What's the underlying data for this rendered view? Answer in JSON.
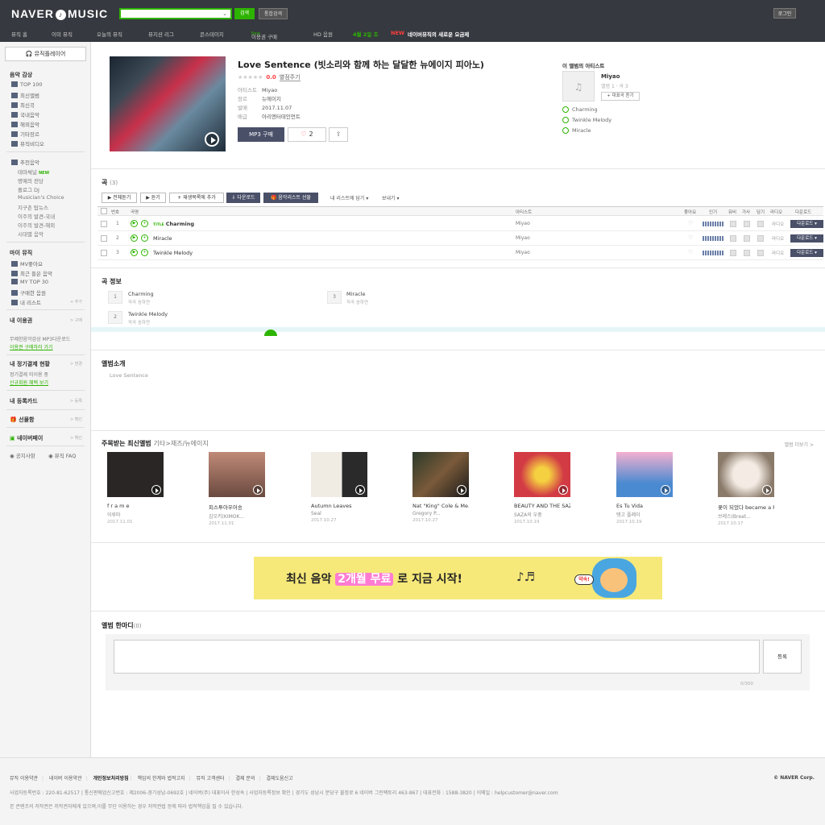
{
  "header": {
    "logo_left": "NAVER",
    "logo_right": "MUSIC",
    "logo_mark": "♪",
    "search_button": "검색",
    "search_all": "통합검색",
    "login": "로그인",
    "menu": [
      "뮤직 홈",
      "이미 뮤직",
      "오늘의 뮤직",
      "뮤지션 리그",
      "콘스테이지",
      "이용권 구매",
      "HD 음원",
      "4월 2일 조",
      "NEW",
      "네이버뮤직의 새로운 요금제"
    ],
    "menu_badge": "New"
  },
  "sidebar": {
    "player_button": "뮤직플레이어",
    "section1_title": "음악 감상",
    "section1_items": [
      "TOP 100",
      "최신앨범",
      "최신곡",
      "국내음악",
      "해외음악",
      "기타장르",
      "뮤직비디오"
    ],
    "recommend_title": "추천음악",
    "recommend_items": [
      "테마채널",
      "명예의 전당",
      "플로그 DJ",
      "Musician's Choice",
      "지구촌 탑뉴스",
      "이주의 발견-국내",
      "이주의 발견-해외",
      "시대별 음악"
    ],
    "recommend_new": "NEW",
    "mymusic_title": "마이 뮤직",
    "mymusic_items": [
      "MV좋아요",
      "최근 들은 음악",
      "MY TOP 30",
      "구매한 음원",
      "내 리스트"
    ],
    "mylist_add": "+ 추가",
    "voucher_title": "내 이용권",
    "voucher_more": "> 구매",
    "voucher_text": "무제한음악감상 MP3다운로드",
    "voucher_link": "이용권 구매하러 가기",
    "subscription_title": "내 정기결제 현황",
    "subscription_more": "> 변경",
    "subscription_text": "정기결제 미이용 중",
    "subscription_link": "신규회원 혜택 보기",
    "mycoupon_title": "내 등록카드",
    "mycoupon_more": "> 등록",
    "gift_title": "선물함",
    "gift_more": "> 확인",
    "naverpay_title": "네이버페이",
    "naverpay_more": "> 확인",
    "notice": "공지사항",
    "faq": "뮤직 FAQ"
  },
  "album": {
    "title": "Love Sentence (빗소리와 함께 하는 달달한 뉴에이지 피아노)",
    "stars": "★★★★★",
    "score": "0.0",
    "rate_button": "별점주기",
    "info": [
      {
        "label": "아티스트",
        "value": "Miyao"
      },
      {
        "label": "장르",
        "value": "뉴에이지"
      },
      {
        "label": "발매",
        "value": "2017.11.07"
      },
      {
        "label": "배급",
        "value": "아리엔터테인먼트"
      }
    ],
    "buy_button": "MP3 구매",
    "like_icon": "♡",
    "like_count": "2",
    "share_icon": "⇪"
  },
  "artist_panel": {
    "heading": "이 앨범의 아티스트",
    "name": "Miyao",
    "meta": "앨범 1 · 곡 3",
    "follow_button": "+ 대표곡 듣기",
    "songs": [
      "Charming",
      "Twinkle Melody",
      "Miracle"
    ]
  },
  "songs_section": {
    "title": "곡",
    "count": "(3)",
    "toolbar": [
      "▶ 전체듣기",
      "▶ 듣기",
      "+ 재생목록에 추가",
      "⇩ 다운로드",
      "🎁 음악리스트 선물"
    ],
    "toolbar_text": [
      "내 리스트에 담기 ▾",
      "보내기 ▾"
    ],
    "headers": [
      "번호",
      "곡명",
      "아티스트",
      "좋아요",
      "인기",
      "뮤비",
      "가사",
      "담기",
      "라디오",
      "다운로드"
    ],
    "rows": [
      {
        "num": "1",
        "title": "Charming",
        "title_badge": "TITLE",
        "artist": "Miyao",
        "radio": "라디오",
        "download": "다운로드 ▾"
      },
      {
        "num": "2",
        "title": "Miracle",
        "title_badge": "",
        "artist": "Miyao",
        "radio": "라디오",
        "download": "다운로드 ▾"
      },
      {
        "num": "3",
        "title": "Twinkle Melody",
        "title_badge": "",
        "artist": "Miyao",
        "radio": "라디오",
        "download": "다운로드 ▾"
      }
    ]
  },
  "song_info": {
    "title": "곡 정보",
    "items": [
      {
        "num": "1",
        "title": "Charming",
        "credit": "작곡 송하얀"
      },
      {
        "num": "3",
        "title": "Miracle",
        "credit": "작곡 송하얀"
      },
      {
        "num": "2",
        "title": "Twinkle Melody",
        "credit": "작곡 송하얀"
      }
    ]
  },
  "album_intro": {
    "title": "앨범소개",
    "text": "Love Sentence"
  },
  "latest": {
    "title": "주목받는 최신앨범",
    "subtitle": "기타>재즈/뉴에이지",
    "more": "앨범 더보기 >",
    "albums": [
      {
        "title": "f r a m e",
        "artist": "이루마",
        "date": "2017.11.01",
        "color": "#2a2625"
      },
      {
        "title": "피스투아우어송",
        "artist": "김오키(KIMOK...",
        "date": "2017.11.01",
        "color": "#8a5a48"
      },
      {
        "title": "Autumn Leaves",
        "artist": "Seal",
        "date": "2017.10.27",
        "color": "#e4e0d8"
      },
      {
        "title": "Nat \"King\" Cole & Me...",
        "artist": "Gregory P...",
        "date": "2017.10.27",
        "color": "#5a4a3c"
      },
      {
        "title": "BEAUTY AND THE SAZA ...",
        "artist": "SAZA의 우중",
        "date": "2017.10.19",
        "color": "#d23a44"
      },
      {
        "title": "Es Tu Vida",
        "artist": "탱고 플레이",
        "date": "2017.10.19",
        "color": "#e86aa6"
      },
      {
        "title": "꽃이 되었다 became a Flow...",
        "artist": "브레스(Breat...",
        "date": "2017.10.17",
        "color": "#d8cfc6"
      }
    ]
  },
  "banner": {
    "text_before": "최신 음악 ",
    "text_highlight": "2개월 무료",
    "text_after": " 로 지금 시작!",
    "note": "♪♬",
    "tag": "약속!"
  },
  "comments": {
    "title": "앨범 한마디",
    "count": "(0)",
    "submit": "등록",
    "counter": "0/300"
  },
  "footer": {
    "links": [
      "뮤직 이용약관",
      "네이버 이용약관",
      "개인정보처리방침",
      "책임의 한계와 법적고지",
      "뮤직 고객센터",
      "결제 문의",
      "결제도움신고"
    ],
    "copyright": "© NAVER Corp.",
    "info1": "사업자등록번호 : 220-81-62517 | 통신판매업신고번호 : 제2006-경기성남-0692호 | 네이버(주) 대표이사 한성숙 | 사업자등록정보 확인 | 경기도 성남시 분당구 불정로 6 네이버 그린팩토리 463-867 | 대표전화 : 1588-3820 | 이메일 : helpcustomer@naver.com",
    "info2": "본 콘텐츠의 저작권은 저작권자에게 있으며,이를 무단 이용하는 경우 저작권법 등에 따라 법적책임을 질 수 있습니다."
  }
}
